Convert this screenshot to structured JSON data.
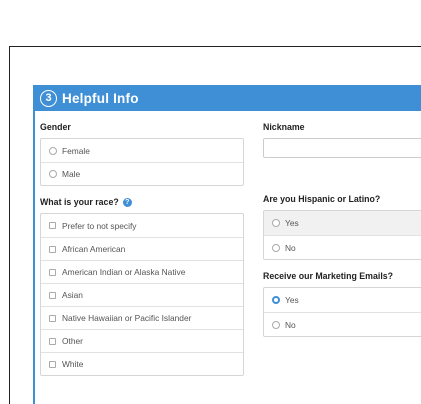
{
  "section": {
    "number": "3",
    "title": "Helpful Info"
  },
  "gender": {
    "label": "Gender",
    "options": [
      "Female",
      "Male"
    ]
  },
  "nickname": {
    "label": "Nickname",
    "value": "",
    "placeholder": ""
  },
  "race": {
    "label": "What is your race?",
    "help_icon": "?",
    "options": [
      "Prefer to not specify",
      "African American",
      "American Indian or Alaska Native",
      "Asian",
      "Native Hawaiian or Pacific Islander",
      "Other",
      "White"
    ]
  },
  "hispanic": {
    "label": "Are you Hispanic or Latino?",
    "options": [
      "Yes",
      "No"
    ]
  },
  "marketing": {
    "label": "Receive our Marketing Emails?",
    "options": [
      "Yes",
      "No"
    ],
    "selected": "Yes"
  },
  "colors": {
    "accent": "#3f8fd6",
    "border": "#d6d6d6"
  }
}
